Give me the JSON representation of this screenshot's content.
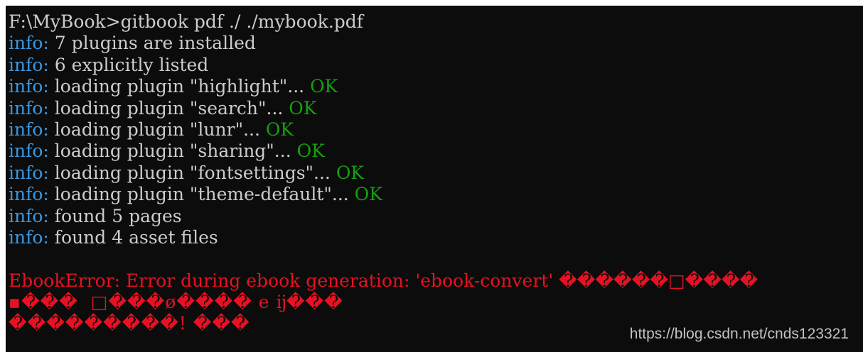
{
  "prompt_line": "F:\\MyBook>gitbook pdf ./ ./mybook.pdf",
  "info_label": "info:",
  "info_lines": [
    {
      "text": " 7 plugins are installed",
      "ok": ""
    },
    {
      "text": " 6 explicitly listed",
      "ok": ""
    },
    {
      "text": " loading plugin \"highlight\"... ",
      "ok": "OK"
    },
    {
      "text": " loading plugin \"search\"... ",
      "ok": "OK"
    },
    {
      "text": " loading plugin \"lunr\"... ",
      "ok": "OK"
    },
    {
      "text": " loading plugin \"sharing\"... ",
      "ok": "OK"
    },
    {
      "text": " loading plugin \"fontsettings\"... ",
      "ok": "OK"
    },
    {
      "text": " loading plugin \"theme-default\"... ",
      "ok": "OK"
    },
    {
      "text": " found 5 pages",
      "ok": ""
    },
    {
      "text": " found 4 asset files",
      "ok": ""
    }
  ],
  "error_line_1": "EbookError: Error during ebook generation: 'ebook-convert' ������□����",
  "error_line_2": "▪���  □���ø���� e ĳ���",
  "error_line_3": "���������! ���",
  "watermark": "https://blog.csdn.net/cnds123321",
  "colors": {
    "background": "#0c0c0c",
    "text": "#cccccc",
    "info": "#3a96dd",
    "ok": "#13a10e",
    "error": "#e81123"
  }
}
